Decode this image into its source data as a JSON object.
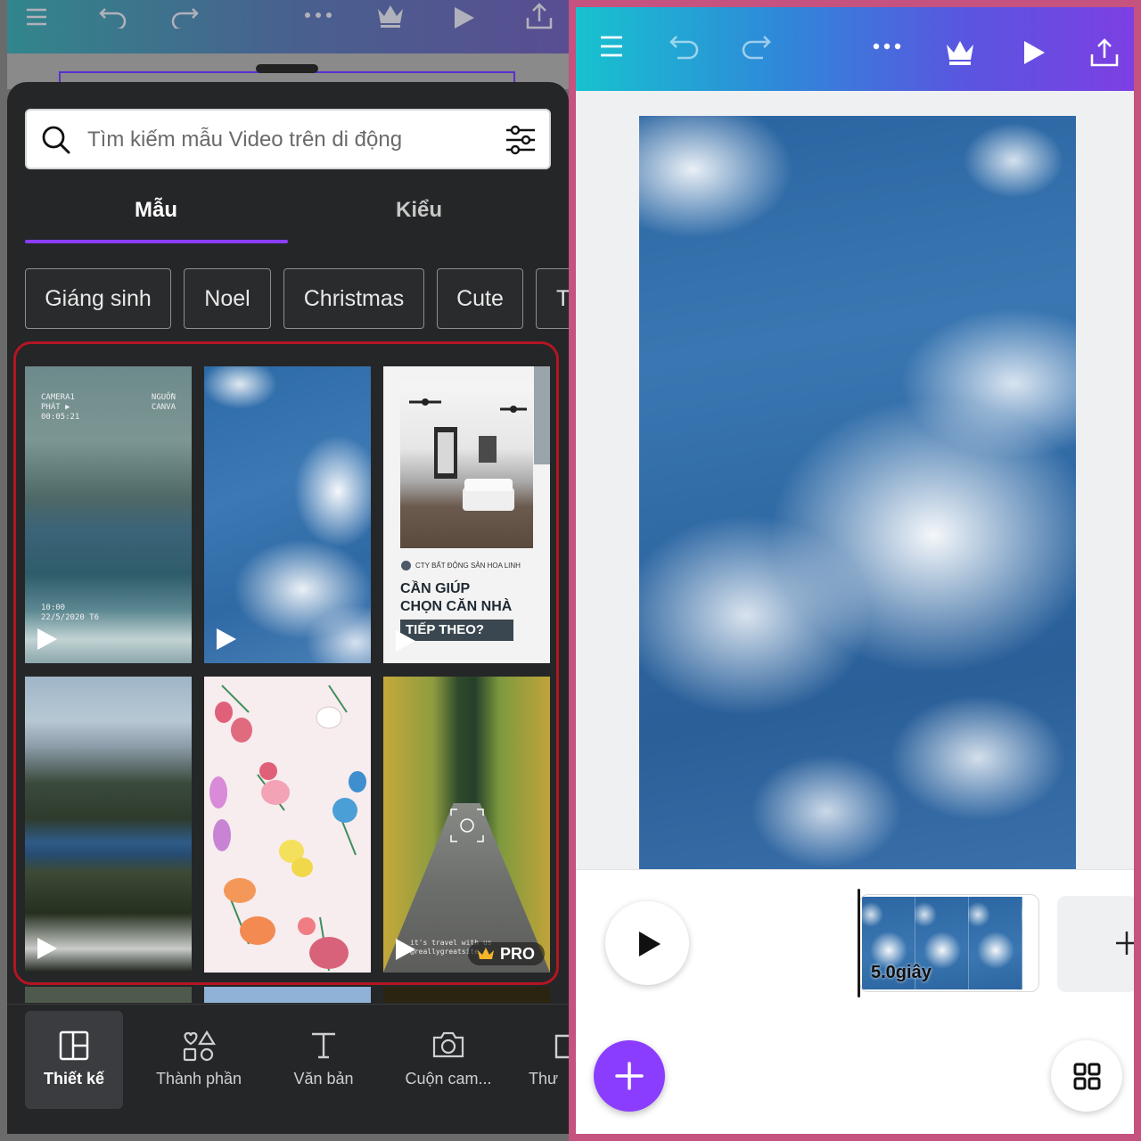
{
  "left_panel": {
    "search": {
      "placeholder": "Tìm kiếm mẫu Video trên di động"
    },
    "tabs": [
      {
        "label": "Mẫu",
        "active": true
      },
      {
        "label": "Kiểu",
        "active": false
      }
    ],
    "chips": [
      "Giáng sinh",
      "Noel",
      "Christmas",
      "Cute",
      "T"
    ],
    "templates": {
      "ocean": {
        "camera_label": "CAMERA1",
        "play_label": "PHÁT ▶",
        "time_code": "00:05:21",
        "source_1": "NGUỒN",
        "source_2": "CANVA",
        "clock": "10:00",
        "date": "22/5/2020 T6"
      },
      "house": {
        "company": "CTY BẤT ĐỘNG SẢN HOA LINH",
        "headline_1": "CẦN GIÚP",
        "headline_2": "CHỌN CĂN NHÀ",
        "headline_3": "TIẾP THEO?"
      },
      "forest": {
        "caption_1": "it's travel with us",
        "caption_2": "@reallygreatsite",
        "badge": "PRO"
      }
    },
    "bottom_nav": [
      {
        "label": "Thiết kế",
        "icon": "layout-icon",
        "active": true
      },
      {
        "label": "Thành phần",
        "icon": "elements-icon",
        "active": false
      },
      {
        "label": "Văn bản",
        "icon": "text-icon",
        "active": false
      },
      {
        "label": "Cuộn cam...",
        "icon": "camera-icon",
        "active": false
      },
      {
        "label": "Thư",
        "icon": "folder-icon",
        "active": false
      }
    ],
    "colors": {
      "accent": "#8b3dff",
      "highlight_frame": "#b41522",
      "sheet": "#252628"
    }
  },
  "right_panel": {
    "toolbar_icons": [
      "menu-icon",
      "undo-icon",
      "redo-icon",
      "more-icon",
      "crown-icon",
      "play-icon",
      "share-icon"
    ],
    "clip": {
      "duration": "5.0giây"
    },
    "colors": {
      "accent": "#8b3dff",
      "gradient_start": "#17c2cf",
      "gradient_end": "#7d3fe3"
    }
  }
}
